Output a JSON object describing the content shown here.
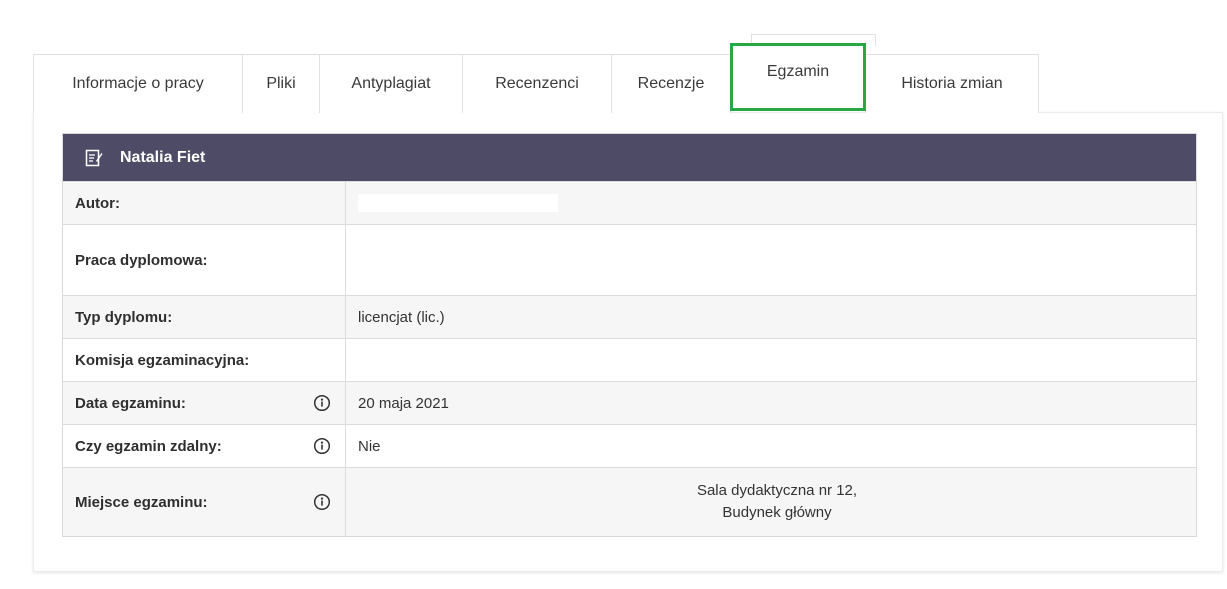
{
  "tabs": [
    {
      "label": "Informacje o pracy",
      "active": false
    },
    {
      "label": "Pliki",
      "active": false
    },
    {
      "label": "Antyplagiat",
      "active": false
    },
    {
      "label": "Recenzenci",
      "active": false
    },
    {
      "label": "Recenzje",
      "active": false
    },
    {
      "label": "Egzamin",
      "active": true
    },
    {
      "label": "Historia zmian",
      "active": false
    }
  ],
  "card": {
    "title": "Natalia Fiet",
    "icon": "edit-note-icon",
    "rows": [
      {
        "label": "Autor:",
        "value": ""
      },
      {
        "label": "Praca dyplomowa:",
        "value": ""
      },
      {
        "label": "Typ dyplomu:",
        "value": "licencjat (lic.)"
      },
      {
        "label": "Komisja egzaminacyjna:",
        "value": ""
      },
      {
        "label": "Data egzaminu:",
        "value": "20 maja 2021",
        "info": true
      },
      {
        "label": "Czy egzamin zdalny:",
        "value": "Nie",
        "info": true
      },
      {
        "label": "Miejsce egzaminu:",
        "value_lines": [
          "Sala dydaktyczna nr 12,",
          "Budynek główny"
        ],
        "info": true
      }
    ]
  },
  "colors": {
    "header_bg": "#4d4b66",
    "active_tab_border": "#27a844",
    "row_alt": "#f6f6f6"
  }
}
